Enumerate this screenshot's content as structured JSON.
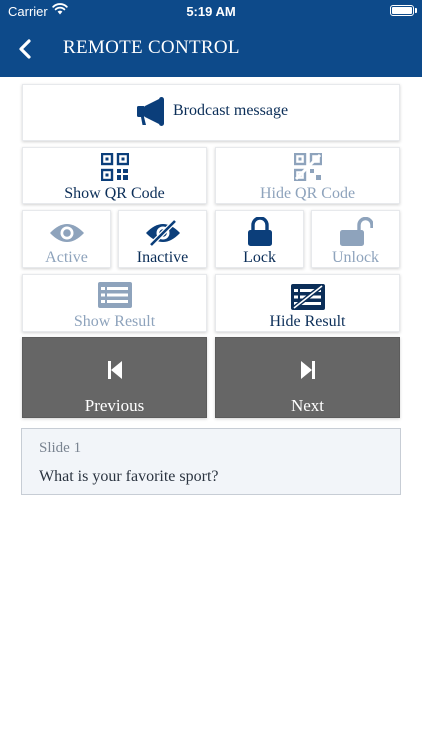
{
  "status": {
    "carrier": "Carrier",
    "time": "5:19 AM"
  },
  "header": {
    "title": "REMOTE CONTROL"
  },
  "controls": {
    "broadcast": "Brodcast message",
    "show_qr": "Show QR Code",
    "hide_qr": "Hide QR Code",
    "active": "Active",
    "inactive": "Inactive",
    "lock": "Lock",
    "unlock": "Unlock",
    "show_result": "Show Result",
    "hide_result": "Hide Result",
    "previous": "Previous",
    "next": "Next"
  },
  "slide": {
    "label": "Slide 1",
    "question": "What is your favorite sport?"
  },
  "colors": {
    "brand": "#0d4a8a",
    "enabled": "#0b2e58",
    "disabled": "#8ea3bc",
    "nav_button": "#666666"
  }
}
